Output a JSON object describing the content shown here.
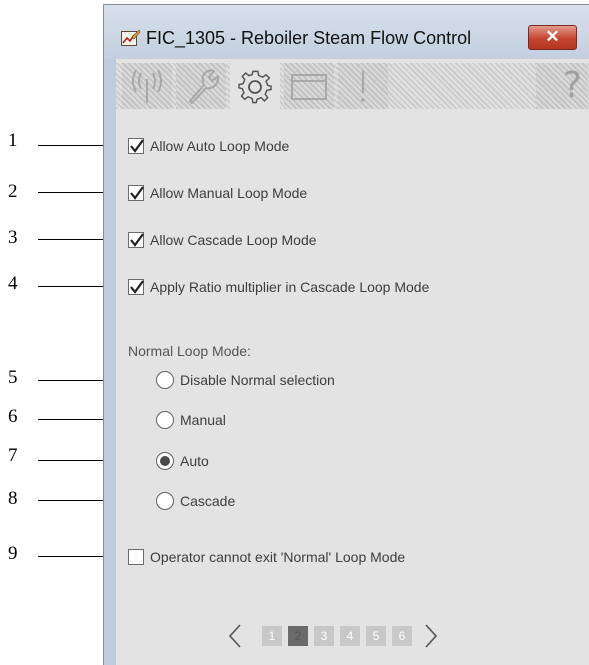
{
  "window": {
    "title": "FIC_1305 - Reboiler Steam Flow Control",
    "close_symbol": "✕"
  },
  "toolbar": {
    "tabs": [
      {
        "icon": "signal-antenna-icon"
      },
      {
        "icon": "wrench-icon"
      },
      {
        "icon": "gear-icon",
        "active": true
      },
      {
        "icon": "window-icon"
      },
      {
        "icon": "exclamation-icon"
      }
    ],
    "help_label": "?"
  },
  "options": {
    "allow_auto": {
      "label": "Allow Auto Loop Mode",
      "checked": true
    },
    "allow_manual": {
      "label": "Allow Manual Loop Mode",
      "checked": true
    },
    "allow_cascade": {
      "label": "Allow Cascade Loop Mode",
      "checked": true
    },
    "apply_ratio": {
      "label": "Apply Ratio multiplier in Cascade Loop Mode",
      "checked": true
    }
  },
  "normal_mode": {
    "label": "Normal Loop Mode:",
    "choices": [
      {
        "label": "Disable Normal selection",
        "selected": false
      },
      {
        "label": "Manual",
        "selected": false
      },
      {
        "label": "Auto",
        "selected": true
      },
      {
        "label": "Cascade",
        "selected": false
      }
    ]
  },
  "operator_lock": {
    "label": "Operator cannot exit 'Normal' Loop Mode",
    "checked": false
  },
  "pager": {
    "pages": [
      "1",
      "2",
      "3",
      "4",
      "5",
      "6"
    ],
    "current": "2"
  },
  "callouts": [
    "1",
    "2",
    "3",
    "4",
    "5",
    "6",
    "7",
    "8",
    "9"
  ],
  "colors": {
    "titlebar": "#c3cfdf",
    "panel": "#e3e3e3",
    "close": "#c64531"
  }
}
